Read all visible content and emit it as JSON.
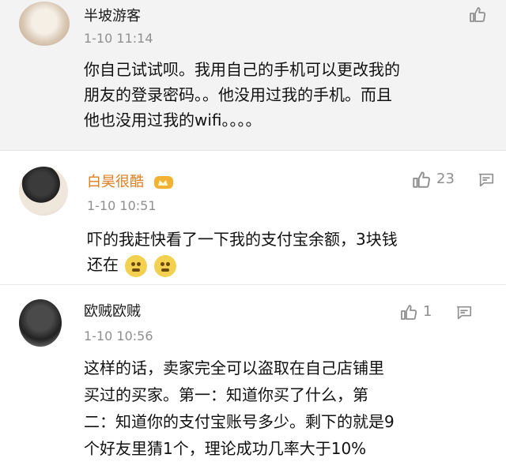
{
  "comments": [
    {
      "username": "半坡游客",
      "time": "1-10 11:14",
      "lines": [
        "你自己试试呗。我用自己的手机可以更改我的",
        "朋友的登录密码。。他没用过我的手机。而且",
        "他也没用过我的wifi。。。。"
      ],
      "like_count": ""
    },
    {
      "username": "白昊很酷",
      "time": "1-10 10:51",
      "lines": [
        "吓的我赶快看了一下我的支付宝余额，3块钱",
        "还在"
      ],
      "like_count": "23",
      "name_color": "#e07d1c"
    },
    {
      "username": "欧贼欧贼",
      "time": "1-10 10:56",
      "lines": [
        "这样的话，卖家完全可以盗取在自己店铺里",
        "买过的买家。第一：知道你买了什么，第",
        "二：知道你的支付宝账号多少。剩下的就是9",
        "个好友里猜1个，理论成功几率大于10%"
      ],
      "like_count": "1"
    }
  ],
  "icons": {
    "like": "thumbs-up-icon",
    "reply": "comment-icon",
    "emoji": "thinking-face-emoji",
    "badge": "crown-badge-icon"
  }
}
